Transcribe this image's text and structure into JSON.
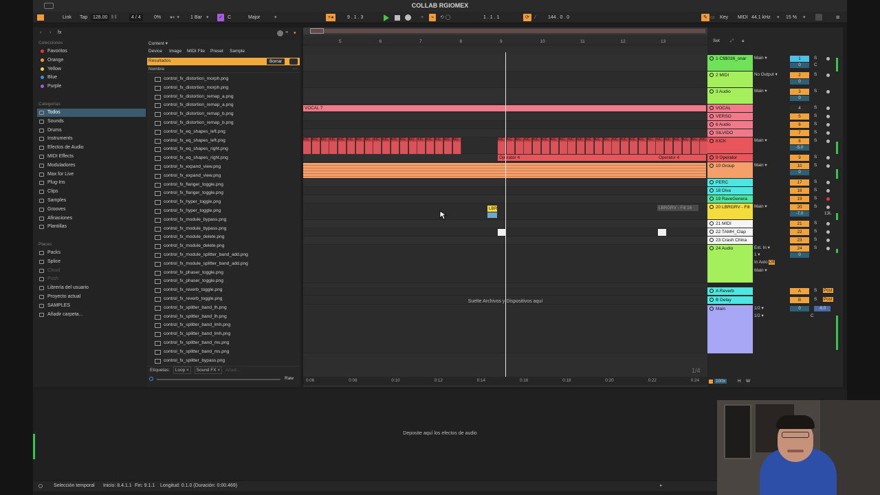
{
  "window": {
    "title": "COLLAB RGIOMEX"
  },
  "control_bar": {
    "link": "Link",
    "tap": "Tap",
    "tempo": "128.00",
    "signature": "4 / 4",
    "cpu_pct": "0%",
    "quantize": "1 Bar",
    "key": "C",
    "scale": "Major",
    "arrangement_position": "9 .   1 .   3",
    "loop_start": "1 .   1 .   1",
    "loop_length": "144 .   0 .   0",
    "key_btn": "Key",
    "midi_btn": "MIDI",
    "sample_rate": "44.1 kHz",
    "cpu_load": "15 %"
  },
  "browser": {
    "search_text": "fx",
    "collections_header": "Colecciones",
    "collections": [
      {
        "label": "Favoritos",
        "color": "#e8363a"
      },
      {
        "label": "Orange",
        "color": "#f39a3c"
      },
      {
        "label": "Yellow",
        "color": "#eddc3b"
      },
      {
        "label": "Blue",
        "color": "#3b8fe6"
      },
      {
        "label": "Purple",
        "color": "#a95ae0"
      }
    ],
    "categories_header": "Categorías",
    "categories": [
      {
        "label": "Todos",
        "icon": "grid-icon"
      },
      {
        "label": "Sounds",
        "icon": "sounds-icon"
      },
      {
        "label": "Drums",
        "icon": "drums-icon"
      },
      {
        "label": "Instruments",
        "icon": "instruments-icon"
      },
      {
        "label": "Efectos de Audio",
        "icon": "audio-fx-icon"
      },
      {
        "label": "MIDI Effects",
        "icon": "midi-fx-icon"
      },
      {
        "label": "Moduladores",
        "icon": "modulators-icon"
      },
      {
        "label": "Max for Live",
        "icon": "max-icon"
      },
      {
        "label": "Plug-Ins",
        "icon": "plugins-icon"
      },
      {
        "label": "Clips",
        "icon": "clips-icon"
      },
      {
        "label": "Samples",
        "icon": "samples-icon"
      },
      {
        "label": "Grooves",
        "icon": "grooves-icon"
      },
      {
        "label": "Afinaciones",
        "icon": "tunings-icon"
      },
      {
        "label": "Plantillas",
        "icon": "templates-icon"
      }
    ],
    "places_header": "Places",
    "places": [
      {
        "label": "Packs",
        "dim": false
      },
      {
        "label": "Splice",
        "dim": false
      },
      {
        "label": "Cloud",
        "dim": true
      },
      {
        "label": "Push",
        "dim": true
      },
      {
        "label": "Librería del usuario",
        "dim": false
      },
      {
        "label": "Proyecto actual",
        "dim": false
      },
      {
        "label": "SAMPLES",
        "dim": false
      },
      {
        "label": "Añadir carpeta...",
        "dim": false
      }
    ],
    "content_dropdown": "Content",
    "filter_tabs": [
      "Device",
      "Image",
      "MIDI File",
      "Preset",
      "Sample"
    ],
    "results_label": "Resultados",
    "clear_button": "Borrar",
    "name_header": "Nombre",
    "files": [
      "control_fx_distortion_morph.png",
      "control_fx_distortion_morph.png",
      "control_fx_distortion_remap_a.png",
      "control_fx_distortion_remap_a.png",
      "control_fx_distortion_remap_b.png",
      "control_fx_distortion_remap_b.png",
      "control_fx_eq_shapes_left.png",
      "control_fx_eq_shapes_left.png",
      "control_fx_eq_shapes_right.png",
      "control_fx_eq_shapes_right.png",
      "control_fx_expand_view.png",
      "control_fx_expand_view.png",
      "control_fx_flanger_toggle.png",
      "control_fx_flanger_toggle.png",
      "control_fx_hyper_toggle.png",
      "control_fx_hyper_toggle.png",
      "control_fx_module_bypass.png",
      "control_fx_module_bypass.png",
      "control_fx_module_delete.png",
      "control_fx_module_delete.png",
      "control_fx_module_splitter_band_add.png",
      "control_fx_module_splitter_band_add.png",
      "control_fx_phaser_toggle.png",
      "control_fx_phaser_toggle.png",
      "control_fx_reverb_toggle.png",
      "control_fx_reverb_toggle.png",
      "control_fx_splitter_band_lh.png",
      "control_fx_splitter_band_lh.png",
      "control_fx_splitter_band_lmh.png",
      "control_fx_splitter_band_lmh.png",
      "control_fx_splitter_band_ms.png",
      "control_fx_splitter_band_ms.png",
      "control_fx_splitter_bypass.png"
    ],
    "tags_label": "Etiquetas:",
    "tags": [
      "Loop",
      "Sound FX"
    ],
    "tags_add": "Añadi...",
    "raw_label": "Raw"
  },
  "arrangement": {
    "bar_numbers": [
      "5",
      "6",
      "7",
      "8",
      "9",
      "10",
      "11",
      "12",
      "13"
    ],
    "clips": {
      "vocal": "VOCAL 7",
      "operator_a": "Operator 4",
      "operator_b": "Operator 4",
      "lbrgrv_a": "LBR",
      "lbrgrv_b": "LBRGRV - Fill 16",
      "kick_label": "KIC"
    },
    "drop_text": "Suelte Archivos y Dispositivos aquí",
    "timeline": [
      "0:06",
      "0:08",
      "0:10",
      "0:12",
      "0:14",
      "0:16",
      "0:18",
      "0:20",
      "0:22",
      "0:24"
    ],
    "page_indicator": "1/4"
  },
  "mixer": {
    "set_label": "Set",
    "tracks": [
      {
        "name": "1 C$$036_snar",
        "color": "#6fe25a",
        "route": "Main",
        "num": "1",
        "num_color": "#4fbfe6",
        "h": 24
      },
      {
        "name": "2 MIDI",
        "color": "#a6ef5c",
        "route": "No Output",
        "num": "2",
        "num_color": "#f0a23c",
        "h": 24
      },
      {
        "name": "3 Audio",
        "color": "#a6ef5c",
        "route": "Main",
        "num": "3",
        "num_color": "#f0a23c",
        "h": 24
      },
      {
        "name": "VOCAL",
        "color": "#f07a8a",
        "route": "",
        "num": "4",
        "num_color": "#2a2a2a",
        "h": 12
      },
      {
        "name": "VERSO",
        "color": "#f07a8a",
        "route": "",
        "num": "5",
        "num_color": "#f0a23c",
        "h": 12
      },
      {
        "name": "6 Audio",
        "color": "#f07a8a",
        "route": "",
        "num": "6",
        "num_color": "#f0a23c",
        "h": 12
      },
      {
        "name": "SILVIDO",
        "color": "#f07a8a",
        "route": "",
        "num": "7",
        "num_color": "#f0a23c",
        "h": 12
      },
      {
        "name": "KICK",
        "color": "#e8565c",
        "route": "Main",
        "num": "8",
        "num_color": "#f0a23c",
        "h": 24
      },
      {
        "name": "9 Operator",
        "color": "#e8565c",
        "route": "",
        "num": "9",
        "num_color": "#f0a23c",
        "h": 12
      },
      {
        "name": "10 Group",
        "color": "#f5a06a",
        "route": "Main",
        "num": "10",
        "num_color": "#f0a23c",
        "h": 24
      },
      {
        "name": "PERC",
        "color": "#4ee6e0",
        "route": "",
        "num": "17",
        "num_color": "#f0a23c",
        "h": 12
      },
      {
        "name": "18 Diva",
        "color": "#4ee6e0",
        "route": "",
        "num": "18",
        "num_color": "#f0a23c",
        "h": 12
      },
      {
        "name": "19 RaveGenera",
        "color": "#4ee6a0",
        "route": "",
        "num": "19",
        "num_color": "#f0a23c",
        "h": 12
      },
      {
        "name": "20 LBRGRV - Fill",
        "color": "#f3dc3b",
        "route": "Main",
        "num": "20",
        "num_color": "#f0a23c",
        "h": 24
      },
      {
        "name": "21 MIDI",
        "color": "#f5f5f5",
        "route": "",
        "num": "21",
        "num_color": "#f0a23c",
        "h": 12
      },
      {
        "name": "22 TAMH_Clap",
        "color": "#f5f5f5",
        "route": "",
        "num": "22",
        "num_color": "#f0a23c",
        "h": 12
      },
      {
        "name": "23 Crash China",
        "color": "#f5f5f5",
        "route": "",
        "num": "23",
        "num_color": "#f0a23c",
        "h": 12
      },
      {
        "name": "24 Audio",
        "color": "#a6ef5c",
        "route": "Ext. In",
        "num": "24",
        "num_color": "#f0a23c",
        "h": 56
      }
    ],
    "returns": [
      {
        "name": "A Reverb",
        "color": "#4ee6e0",
        "num": "A"
      },
      {
        "name": "B Delay",
        "color": "#4ee6e0",
        "num": "B"
      }
    ],
    "main": {
      "name": "Main",
      "color": "#a7a7f5",
      "fraction": "1/2",
      "fraction2": "1/2",
      "vol": "0",
      "pan": "C",
      "db": "-6.0"
    },
    "monitor": {
      "in": "In",
      "auto": "Auto",
      "off": "Off"
    },
    "vol_values": {
      "t1": "0",
      "t1_pan": "C",
      "kick": "-5.0",
      "lbr": "-7.0",
      "lbr_pan": "13L"
    },
    "bottom": {
      "zoom": "100x",
      "h": "H",
      "w": "W"
    }
  },
  "detail": {
    "drop_text": "Deposite aquí los efectos de audio"
  },
  "status": {
    "mode": "Selección temporal",
    "start": "Inicio: 8.4.1.1",
    "end": "Fin: 9.1.1",
    "length": "Longitud: 0.1.0 (Duración: 0:00.469)"
  }
}
